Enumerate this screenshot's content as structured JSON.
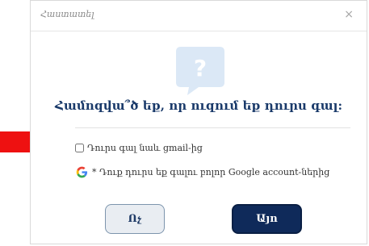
{
  "dialog": {
    "title": "Հաստատել",
    "close_symbol": "×",
    "icon": "question-bubble-icon",
    "question": "Համոզվա՞ծ եք, որ ուզում եք դուրս գալ:",
    "checkbox_label": "Դուրս գալ նաև gmail-ից",
    "checkbox_checked": false,
    "google_note": "* Դուք դուրս եք գալու բոլոր Google account-ներից",
    "no_label": "Ոչ",
    "yes_label": "Այո"
  },
  "annotation": {
    "icon": "red-arrow-icon",
    "color": "#ee1111"
  },
  "colors": {
    "primary": "#0f2a5a",
    "bubble": "#dbe8f6",
    "question_text": "#1a3a6a"
  }
}
